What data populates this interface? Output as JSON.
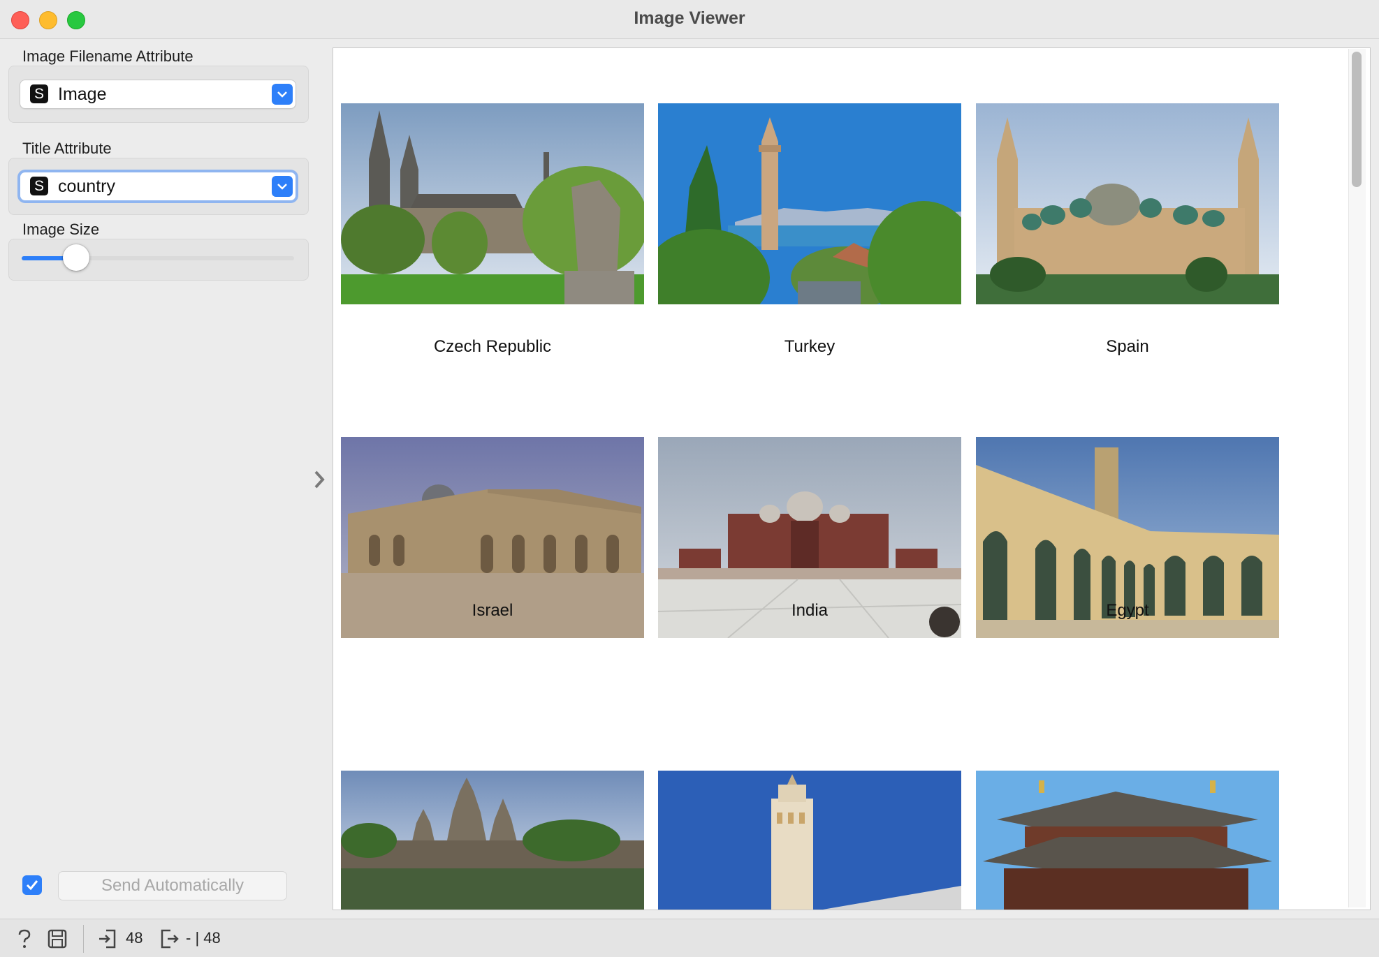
{
  "window": {
    "title": "Image Viewer"
  },
  "sidebar": {
    "filename_label": "Image Filename Attribute",
    "filename_value": "Image",
    "filename_type_badge": "S",
    "title_label": "Title Attribute",
    "title_value": "country",
    "title_type_badge": "S",
    "size_label": "Image Size",
    "size_level": 0.2,
    "send_auto_checked": true,
    "send_button_label": "Send Automatically"
  },
  "gallery": {
    "items": [
      {
        "title": "Czech Republic"
      },
      {
        "title": "Turkey"
      },
      {
        "title": "Spain"
      },
      {
        "title": "Israel"
      },
      {
        "title": "India"
      },
      {
        "title": "Egypt"
      },
      {
        "title": ""
      },
      {
        "title": ""
      },
      {
        "title": ""
      }
    ]
  },
  "status": {
    "input_count": "48",
    "output_count": "- | 48"
  },
  "icons": [
    "help-icon",
    "save-icon",
    "input-icon",
    "output-icon",
    "chevron-down-icon",
    "chevron-right-icon",
    "checkmark-icon"
  ],
  "colors": {
    "accent": "#2d7ff9"
  }
}
